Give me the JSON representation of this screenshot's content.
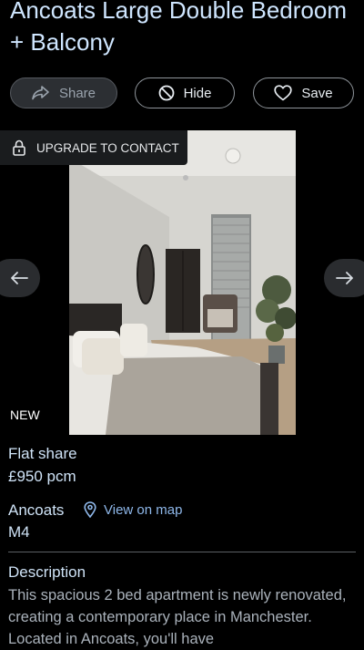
{
  "listing": {
    "title": "Ancoats Large Double Bedroom + Balcony",
    "type": "Flat share",
    "price": "£950 pcm",
    "area": "Ancoats",
    "postcode": "M4",
    "badge": "NEW"
  },
  "actions": {
    "share_label": "Share",
    "hide_label": "Hide",
    "save_label": "Save"
  },
  "gallery": {
    "upgrade_label": "UPGRADE TO CONTACT"
  },
  "location": {
    "map_link_label": "View on map"
  },
  "description": {
    "heading": "Description",
    "text": "This spacious 2 bed apartment is newly renovated, creating a contemporary place in Manchester. Located in Ancoats, you'll have"
  },
  "icons": {
    "share": "share-arrow-icon",
    "hide": "block-icon",
    "save": "heart-icon",
    "lock": "lock-icon",
    "prev": "arrow-left-icon",
    "next": "arrow-right-icon",
    "map_pin": "map-pin-icon"
  },
  "colors": {
    "background": "#000000",
    "heading_text": "#cfe6ff",
    "link": "#8fb8ea",
    "share_button_bg": "#2c2f33"
  }
}
